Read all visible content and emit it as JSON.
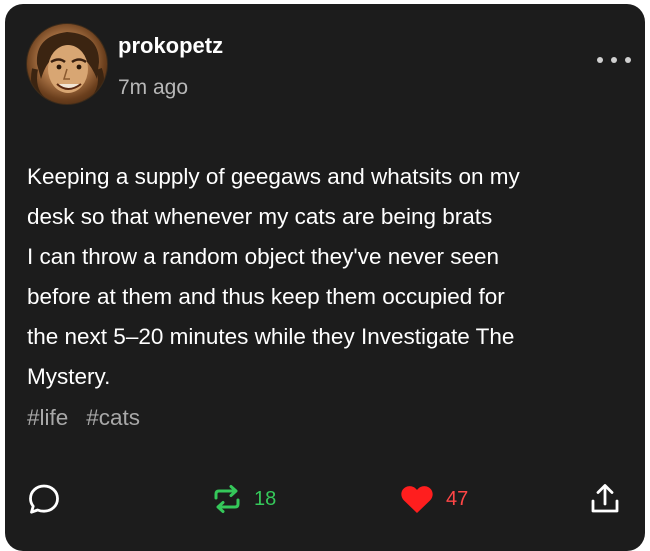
{
  "post": {
    "author": {
      "username": "prokopetz",
      "avatar_icon": "author-portrait"
    },
    "timestamp": "7m ago",
    "more_icon": "ellipsis-icon",
    "body_lines": [
      "Keeping a supply of geegaws and whatsits on my",
      "desk so that whenever my cats are being brats",
      "I can throw a random object they've never seen",
      "before at them and thus keep them occupied for",
      "the next 5–20 minutes while they Investigate The",
      "Mystery."
    ],
    "tags": [
      "#life",
      "#cats"
    ]
  },
  "actions": {
    "reply": {
      "icon": "speech-bubble-icon"
    },
    "reblog": {
      "icon": "reblog-arrows-icon",
      "count": "18",
      "color": "#35c85a"
    },
    "like": {
      "icon": "heart-icon",
      "count": "47",
      "color": "#ff4646"
    },
    "share": {
      "icon": "share-upload-icon"
    }
  },
  "colors": {
    "card_background": "#1c1c1c",
    "text_primary": "#ffffff",
    "text_secondary": "#b8b8b8",
    "tag_text": "#a8a8a8"
  }
}
